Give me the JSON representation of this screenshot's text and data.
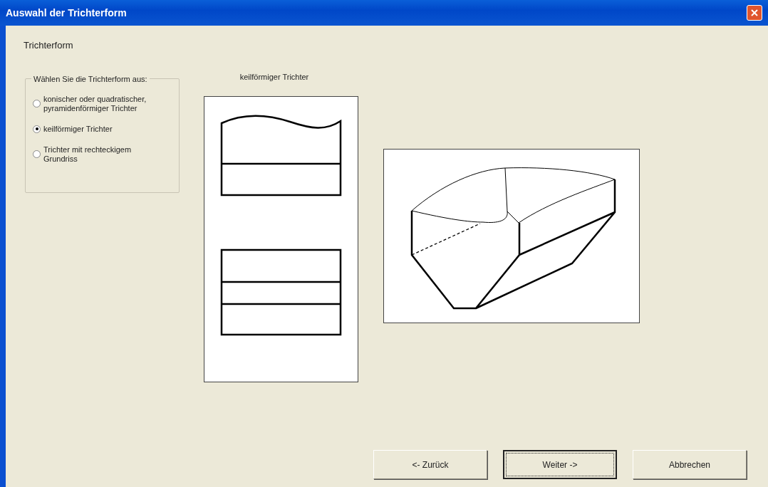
{
  "window": {
    "title": "Auswahl der Trichterform"
  },
  "heading": "Trichterform",
  "group": {
    "caption": "Wählen Sie die Trichterform aus:",
    "options": [
      {
        "label": "konischer oder quadratischer, pyramidenförmiger Trichter",
        "selected": false
      },
      {
        "label": "keilförmiger Trichter",
        "selected": true
      },
      {
        "label": "Trichter mit rechteckigem Grundriss",
        "selected": false
      }
    ]
  },
  "preview": {
    "caption": "keilförmiger Trichter"
  },
  "buttons": [
    {
      "label": "<- Zurück",
      "focused": false
    },
    {
      "label": "Weiter ->",
      "focused": true
    },
    {
      "label": "Abbrechen",
      "focused": false
    }
  ]
}
